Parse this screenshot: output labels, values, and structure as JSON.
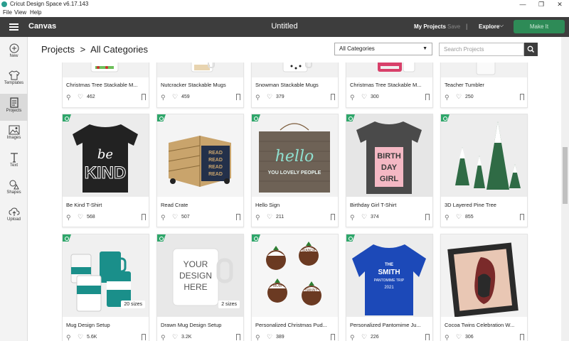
{
  "window": {
    "title": "Cricut Design Space  v6.17.143"
  },
  "menu": [
    "File",
    "View",
    "Help"
  ],
  "appbar": {
    "section": "Canvas",
    "doc_title": "Untitled",
    "my_projects": "My Projects",
    "save": "Save",
    "separator": "|",
    "explore": "Explore",
    "make_it": "Make It"
  },
  "sidebar": [
    {
      "label": "New",
      "icon": "plus-circle-icon"
    },
    {
      "label": "Templates",
      "icon": "tshirt-icon"
    },
    {
      "label": "Projects",
      "icon": "projects-icon",
      "active": true
    },
    {
      "label": "Images",
      "icon": "image-icon"
    },
    {
      "label": "Text",
      "icon": "text-icon"
    },
    {
      "label": "Shapes",
      "icon": "shapes-icon"
    },
    {
      "label": "Upload",
      "icon": "upload-icon"
    }
  ],
  "breadcrumb": {
    "root": "Projects",
    "sep": ">",
    "current": "All Categories"
  },
  "filter": {
    "selected": "All Categories"
  },
  "search": {
    "placeholder": "Search Projects"
  },
  "rows": [
    [
      {
        "name": "Christmas Tree Stackable M...",
        "likes": "462"
      },
      {
        "name": "Nutcracker Stackable Mugs",
        "likes": "459"
      },
      {
        "name": "Snowman Stackable Mugs",
        "likes": "379"
      },
      {
        "name": "Christmas Tree Stackable M...",
        "likes": "300"
      },
      {
        "name": "Teacher Tumbler",
        "likes": "250"
      }
    ],
    [
      {
        "name": "Be Kind T-Shirt",
        "likes": "568",
        "art": [
          "be",
          "KIND"
        ]
      },
      {
        "name": "Read Crate",
        "likes": "507",
        "art": [
          "READ",
          "READ",
          "READ",
          "READ"
        ]
      },
      {
        "name": "Hello Sign",
        "likes": "211",
        "art": [
          "hello",
          "YOU LOVELY PEOPLE"
        ]
      },
      {
        "name": "Birthday Girl T-Shirt",
        "likes": "374",
        "art": [
          "BIRTH",
          "DAY",
          "GIRL"
        ]
      },
      {
        "name": "3D Layered Pine Tree",
        "likes": "855"
      }
    ],
    [
      {
        "name": "Mug Design Setup",
        "likes": "5.6K",
        "sizes": "20 sizes"
      },
      {
        "name": "Drawn Mug Design Setup",
        "likes": "3.2K",
        "sizes": "2 sizes",
        "art": [
          "YOUR",
          "DESIGN",
          "HERE"
        ]
      },
      {
        "name": "Personalized Christmas Pud...",
        "likes": "389",
        "art": [
          "DAVE",
          "WANDA",
          "MUM",
          "NANNY"
        ]
      },
      {
        "name": "Personalized Pantomime Ju...",
        "likes": "226",
        "art": [
          "THE",
          "SMITH",
          "PANTOMIME TRIP",
          "2021"
        ]
      },
      {
        "name": "Cocoa Twins Celebration W...",
        "likes": "306"
      }
    ]
  ]
}
